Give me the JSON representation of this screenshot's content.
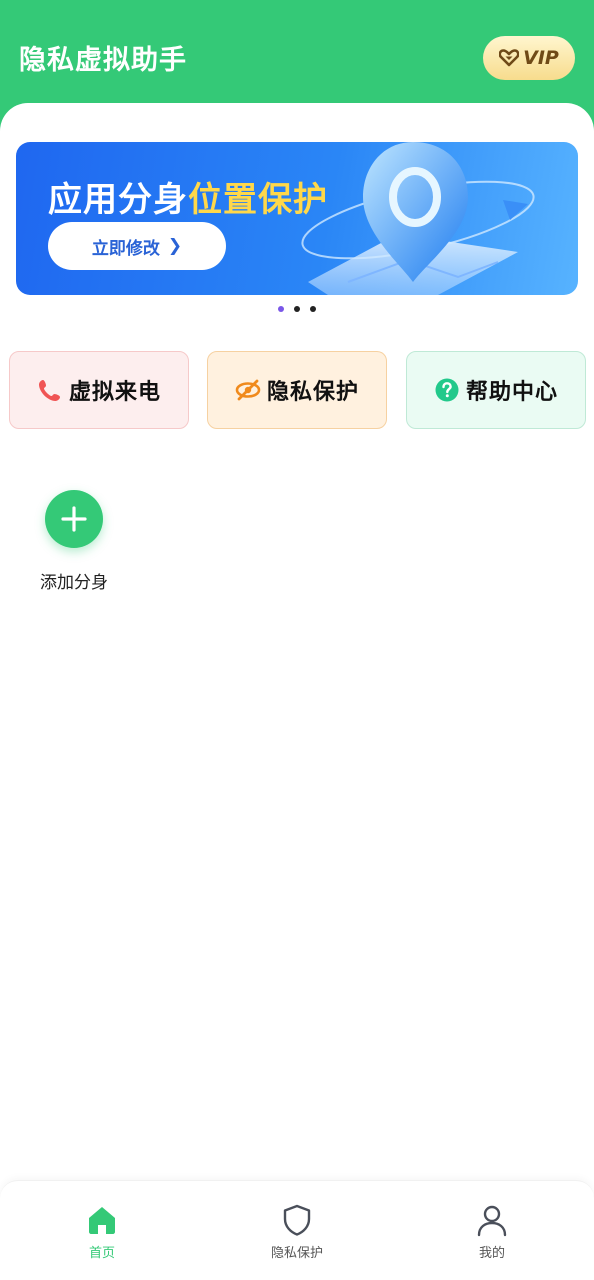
{
  "header": {
    "title": "隐私虚拟助手",
    "vip_label": "VIP"
  },
  "banner": {
    "title_part1": "应用分身",
    "title_highlight": "位置保护",
    "button_label": "立即修改",
    "button_arrow": "❯",
    "page_count": 3,
    "active_page": 1
  },
  "quick_actions": [
    {
      "label": "虚拟来电",
      "icon": "phone-icon",
      "color": "#f05454"
    },
    {
      "label": "隐私保护",
      "icon": "eye-slash-icon",
      "color": "#f08a1c"
    },
    {
      "label": "帮助中心",
      "icon": "question-icon",
      "color": "#22c98b"
    }
  ],
  "add_clone": {
    "label": "添加分身",
    "icon": "plus-icon"
  },
  "bottom_nav": [
    {
      "label": "首页",
      "icon": "home-icon",
      "active": true
    },
    {
      "label": "隐私保护",
      "icon": "shield-icon",
      "active": false
    },
    {
      "label": "我的",
      "icon": "user-icon",
      "active": false
    }
  ],
  "colors": {
    "primary": "#34c977",
    "banner_blue": "#1f67f0",
    "highlight_yellow": "#ffd84a",
    "vip_gold": "#6f4a17"
  }
}
